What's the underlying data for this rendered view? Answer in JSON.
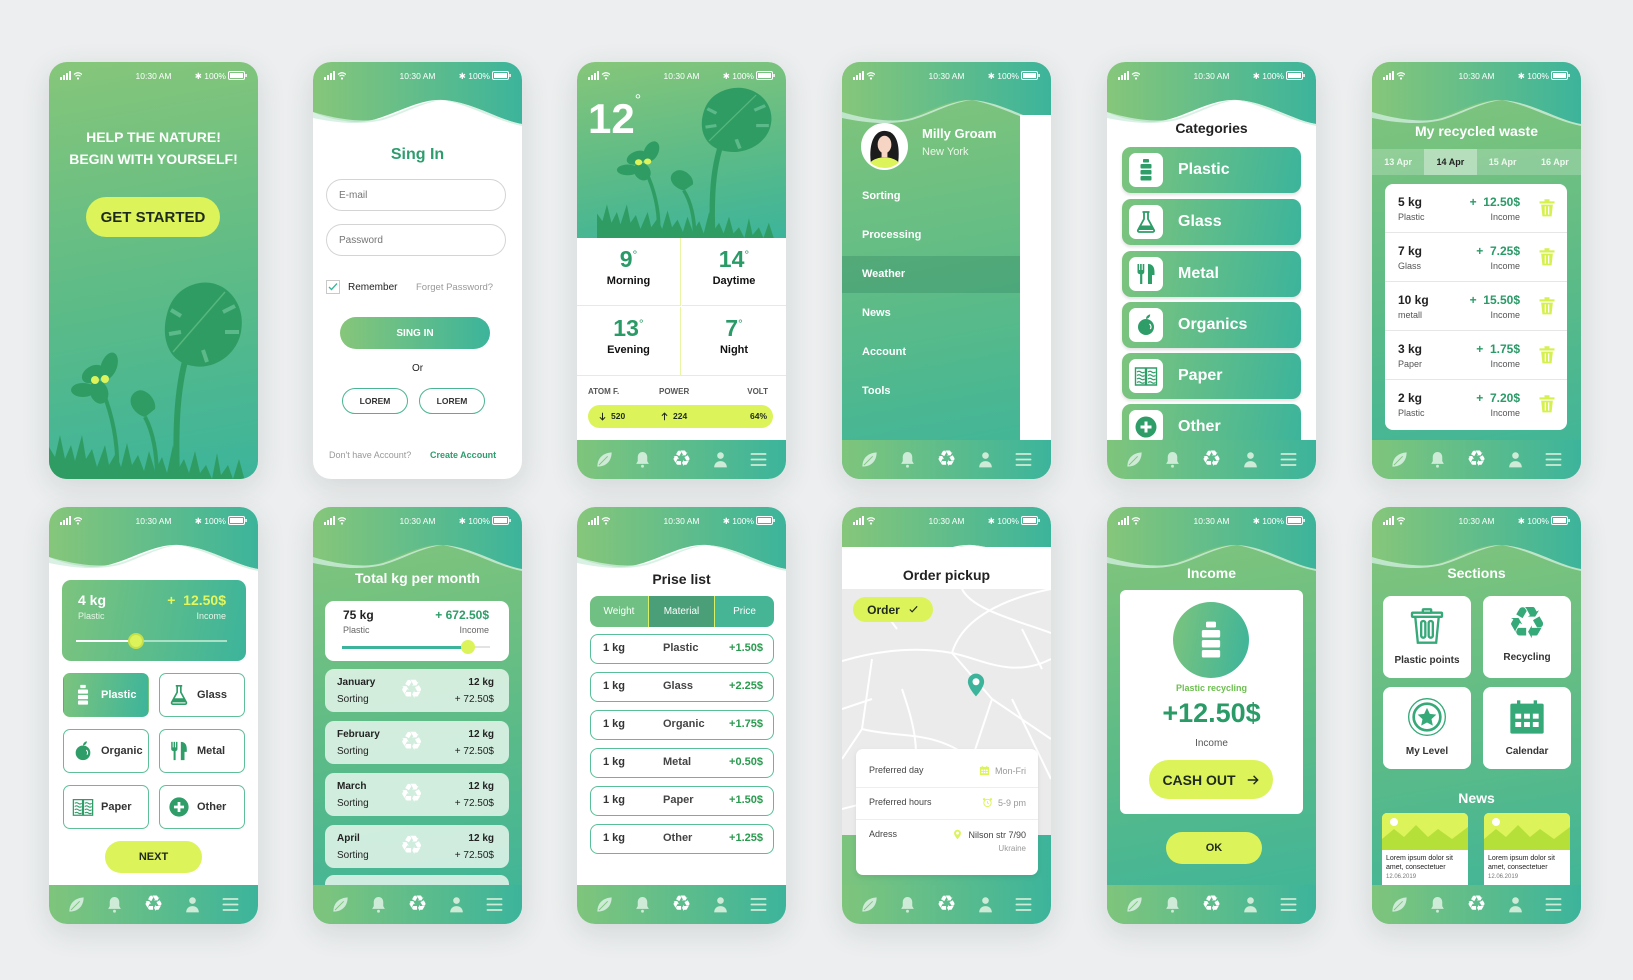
{
  "status": {
    "time": "10:30 AM",
    "battery": "100%"
  },
  "colors": {
    "green_light": "#86c67a",
    "green_teal": "#3cb49b",
    "accent_yellow": "#dcf35a",
    "text_green": "#2a9a67"
  },
  "nav": {
    "icons": [
      "leaf-icon",
      "bell-icon",
      "recycle-icon",
      "user-icon",
      "menu-icon"
    ],
    "recycle_glyph": "♻"
  },
  "welcome": {
    "headline_1": "HELP THE NATURE!",
    "headline_2": "BEGIN WITH YOURSELF!",
    "cta": "GET STARTED"
  },
  "signin": {
    "title": "Sing In",
    "email_placeholder": "E-mail",
    "password_placeholder": "Password",
    "remember": "Remember",
    "remember_checked": true,
    "forgot": "Forget Password?",
    "submit": "SING IN",
    "or": "Or",
    "alt_buttons": [
      "LOREM",
      "LOREM"
    ],
    "no_account": "Don't have Account?",
    "create": "Create Account"
  },
  "weather": {
    "current": "12",
    "degree": "°",
    "periods": [
      {
        "temp": "9",
        "label": "Morning"
      },
      {
        "temp": "14",
        "label": "Daytime"
      },
      {
        "temp": "13",
        "label": "Evening"
      },
      {
        "temp": "7",
        "label": "Night"
      }
    ],
    "stats": [
      {
        "label": "ATOM F.",
        "value": "520",
        "icon": "arrow-down-icon"
      },
      {
        "label": "POWER",
        "value": "224",
        "icon": "arrow-up-icon"
      },
      {
        "label": "VOLT",
        "value": "64%"
      }
    ]
  },
  "menu": {
    "name": "Milly Groam",
    "city": "New York",
    "items": [
      "Sorting",
      "Processing",
      "Weather",
      "News",
      "Account",
      "Tools"
    ],
    "active": "Weather"
  },
  "categories": {
    "title": "Categories",
    "items": [
      {
        "label": "Plastic",
        "icon": "bottle-icon"
      },
      {
        "label": "Glass",
        "icon": "flask-icon"
      },
      {
        "label": "Metal",
        "icon": "cutlery-icon"
      },
      {
        "label": "Organics",
        "icon": "apple-icon"
      },
      {
        "label": "Paper",
        "icon": "book-icon"
      },
      {
        "label": "Other",
        "icon": "plus-circle-icon"
      }
    ]
  },
  "recycled": {
    "title": "My recycled waste",
    "dates": [
      "13 Apr",
      "14 Apr",
      "15 Apr",
      "16 Apr"
    ],
    "active_date": "14 Apr",
    "rows": [
      {
        "weight": "5 kg",
        "material": "Plastic",
        "amount": "+  12.50$",
        "amount_label": "Income"
      },
      {
        "weight": "7 kg",
        "material": "Glass",
        "amount": "+  7.25$",
        "amount_label": "Income"
      },
      {
        "weight": "10 kg",
        "material": "metall",
        "amount": "+  15.50$",
        "amount_label": "Income"
      },
      {
        "weight": "3 kg",
        "material": "Paper",
        "amount": "+  1.75$",
        "amount_label": "Income"
      },
      {
        "weight": "2 kg",
        "material": "Plastic",
        "amount": "+  7.20$",
        "amount_label": "Income"
      }
    ]
  },
  "sorting": {
    "weight": "4 kg",
    "material": "Plastic",
    "amount": "+  12.50$",
    "amount_label": "Income",
    "slider_value": 0.4,
    "options": [
      {
        "label": "Plastic",
        "icon": "bottle-icon"
      },
      {
        "label": "Glass",
        "icon": "flask-icon"
      },
      {
        "label": "Organic",
        "icon": "apple-icon"
      },
      {
        "label": "Metal",
        "icon": "cutlery-icon"
      },
      {
        "label": "Paper",
        "icon": "book-icon"
      },
      {
        "label": "Other",
        "icon": "plus-circle-icon"
      }
    ],
    "selected": "Plastic",
    "next": "NEXT"
  },
  "monthly": {
    "title": "Total kg per month",
    "total_weight": "75 kg",
    "material": "Plastic",
    "total_amount": "+ 672.50$",
    "amount_label": "Income",
    "progress": 0.85,
    "months": [
      {
        "month": "January",
        "label": "Sorting",
        "weight": "12 kg",
        "amount": "+ 72.50$"
      },
      {
        "month": "February",
        "label": "Sorting",
        "weight": "12 kg",
        "amount": "+ 72.50$"
      },
      {
        "month": "March",
        "label": "Sorting",
        "weight": "12 kg",
        "amount": "+ 72.50$"
      },
      {
        "month": "April",
        "label": "Sorting",
        "weight": "12 kg",
        "amount": "+ 72.50$"
      }
    ]
  },
  "prices": {
    "title": "Prise list",
    "columns": [
      "Weight",
      "Material",
      "Price"
    ],
    "active_column": "Material",
    "rows": [
      {
        "weight": "1 kg",
        "material": "Plastic",
        "price": "+1.50$"
      },
      {
        "weight": "1 kg",
        "material": "Glass",
        "price": "+2.25$"
      },
      {
        "weight": "1 kg",
        "material": "Organic",
        "price": "+1.75$"
      },
      {
        "weight": "1 kg",
        "material": "Metal",
        "price": "+0.50$"
      },
      {
        "weight": "1 kg",
        "material": "Paper",
        "price": "+1.50$"
      },
      {
        "weight": "1 kg",
        "material": "Other",
        "price": "+1.25$"
      }
    ]
  },
  "order": {
    "title": "Order pickup",
    "order_button": "Order",
    "details": [
      {
        "label": "Preferred day",
        "value": "Mon-Fri",
        "icon": "calendar-icon"
      },
      {
        "label": "Preferred hours",
        "value": "5-9 pm",
        "icon": "alarm-clock-icon"
      },
      {
        "label": "Adress",
        "value": "Nilson str 7/90",
        "value2": "Ukraine",
        "icon": "location-pin-icon"
      }
    ]
  },
  "income": {
    "title": "Income",
    "category": "Plastic recycling",
    "amount": "+12.50$",
    "amount_label": "Income",
    "cash_out": "CASH OUT",
    "ok": "OK"
  },
  "sections": {
    "title": "Sections",
    "tiles": [
      {
        "label": "Plastic points",
        "icon": "trash-bin-icon"
      },
      {
        "label": "Recycling",
        "icon": "recycle-icon"
      },
      {
        "label": "My Level",
        "icon": "star-badge-icon"
      },
      {
        "label": "Calendar",
        "icon": "calendar-icon"
      }
    ],
    "news_title": "News",
    "news": [
      {
        "text": "Lorem ipsum dolor sit amet, consectetuer",
        "date": "12.06.2019"
      },
      {
        "text": "Lorem ipsum dolor sit amet, consectetuer",
        "date": "12.06.2019"
      }
    ]
  }
}
